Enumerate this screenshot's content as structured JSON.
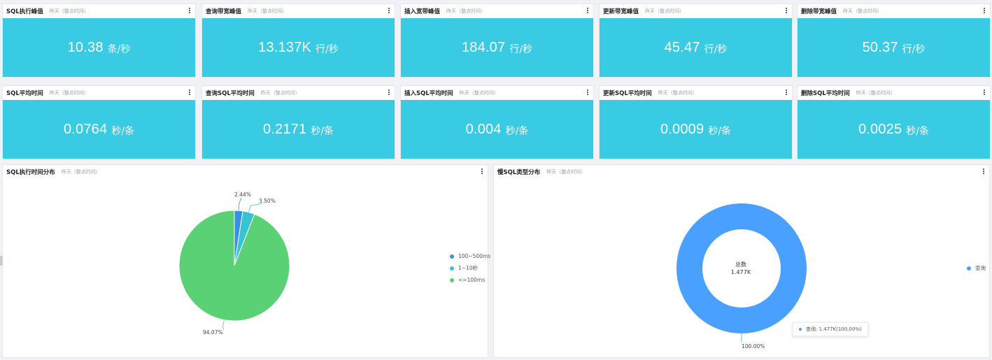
{
  "kpi_cards": [
    {
      "title": "SQL执行峰值",
      "subtitle": "昨天（整点时间）",
      "value": "10.38",
      "unit": "条/秒"
    },
    {
      "title": "查询带宽峰值",
      "subtitle": "昨天（整点时间）",
      "value": "13.137K",
      "unit": "行/秒"
    },
    {
      "title": "插入宽带峰值",
      "subtitle": "昨天（整点时间）",
      "value": "184.07",
      "unit": "行/秒"
    },
    {
      "title": "更新带宽峰值",
      "subtitle": "昨天（整点时间）",
      "value": "45.47",
      "unit": "行/秒"
    },
    {
      "title": "删除带宽峰值",
      "subtitle": "昨天（整点时间）",
      "value": "50.37",
      "unit": "行/秒"
    },
    {
      "title": "SQL平均时间",
      "subtitle": "昨天（整点时间）",
      "value": "0.0764",
      "unit": "秒/条"
    },
    {
      "title": "查询SQL平均时间",
      "subtitle": "昨天（整点时间）",
      "value": "0.2171",
      "unit": "秒/条"
    },
    {
      "title": "插入SQL平均时间",
      "subtitle": "昨天（整点时间）",
      "value": "0.004",
      "unit": "秒/条"
    },
    {
      "title": "更新SQL平均时间",
      "subtitle": "昨天（整点时间）",
      "value": "0.0009",
      "unit": "秒/条"
    },
    {
      "title": "删除SQL平均时间",
      "subtitle": "昨天（整点时间）",
      "value": "0.0025",
      "unit": "秒/条"
    }
  ],
  "pie_panel": {
    "title": "SQL执行时间分布",
    "subtitle": "昨天（整点时间）"
  },
  "donut_panel": {
    "title": "慢SQL类型分布",
    "subtitle": "昨天（整点时间）",
    "center_label": "总数",
    "center_value": "1.477K",
    "tooltip": "查询: 1.477K(100.00%)"
  },
  "chart_data": [
    {
      "type": "pie",
      "categories": [
        "100~500ms",
        "1~10秒",
        "<=100ms"
      ],
      "values": [
        2.44,
        3.5,
        94.07
      ],
      "data_labels": [
        "2.44%",
        "3.50%",
        "94.07%"
      ],
      "colors": [
        "#3a8ee6",
        "#36c5d0",
        "#5ad175"
      ],
      "legend": "right"
    },
    {
      "type": "pie",
      "categories": [
        "查询"
      ],
      "values": [
        100.0
      ],
      "data_labels": [
        "100.00%"
      ],
      "colors": [
        "#4aa0ff"
      ],
      "legend": "right"
    }
  ],
  "colors": {
    "kpi_bg": "#38cbe3"
  }
}
